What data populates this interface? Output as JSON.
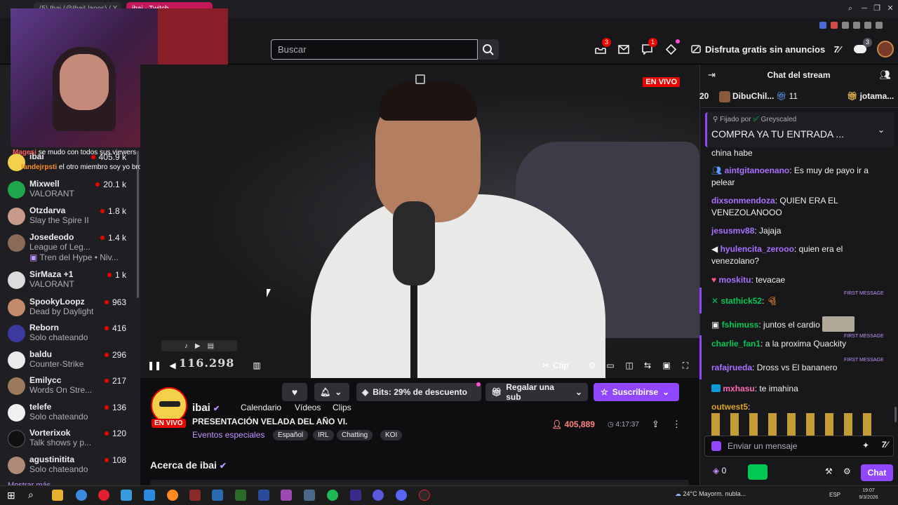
{
  "browser": {
    "tabs": [
      {
        "label": "(5) Ibai (@IbaiLlanos) / X"
      },
      {
        "label": "ibai - Twitch"
      }
    ]
  },
  "topnav": {
    "search_placeholder": "Buscar",
    "notif_badge_1": "3",
    "notif_badge_2": "1",
    "notif_badge_3": "3",
    "no_ads_label": "Disfruta gratis sin anuncios"
  },
  "webcam_overlay": {
    "line1_user": "Magesi",
    "line1_text": "se mudo con todos sus viewers",
    "line2_user": "fandejrpsti",
    "line2_text": "el otro miembro soy yo bro"
  },
  "sidebar": {
    "items": [
      {
        "name": "ibai",
        "game": "",
        "viewers": "405.9 k",
        "color": "#f2d04a"
      },
      {
        "name": "Mixwell",
        "game": "VALORANT",
        "viewers": "20.1 k",
        "color": "#1fa64a"
      },
      {
        "name": "Otzdarva",
        "game": "Slay the Spire II",
        "viewers": "1.8 k",
        "color": "#c79a8a"
      },
      {
        "name": "Josedeodo",
        "game": "League of Leg...",
        "viewers": "1.4 k",
        "color": "#8a6a58"
      },
      {
        "name": "SirMaza +1",
        "game": "VALORANT",
        "viewers": "1 k",
        "color": "#dcdcdc"
      },
      {
        "name": "SpookyLoopz",
        "game": "Dead by Daylight",
        "viewers": "963",
        "color": "#c28a6a"
      },
      {
        "name": "Reborn",
        "game": "Solo chateando",
        "viewers": "416",
        "color": "#3a3aa0"
      },
      {
        "name": "baldu",
        "game": "Counter-Strike",
        "viewers": "296",
        "color": "#eaeaea"
      },
      {
        "name": "Emilycc",
        "game": "Words On Stre...",
        "viewers": "217",
        "color": "#9a7a5a"
      },
      {
        "name": "telefe",
        "game": "Solo chateando",
        "viewers": "136",
        "color": "#f0f0f0"
      },
      {
        "name": "Vorterixok",
        "game": "Talk shows y p...",
        "viewers": "120",
        "color": "#111111"
      },
      {
        "name": "agustinitita",
        "game": "Solo chateando",
        "viewers": "108",
        "color": "#b08878"
      }
    ],
    "hype_train": "Tren del Hype • Niv...",
    "show_more": "Mostrar más"
  },
  "video": {
    "live_badge": "EN VIVO",
    "counter": "116.298",
    "clip_label": "Clip"
  },
  "channel": {
    "name": "ibai",
    "live": "EN VIVO",
    "tabs": [
      "Calendario",
      "Vídeos",
      "Clips"
    ],
    "title": "PRESENTACIÓN VELADA DEL AÑO VI.",
    "category": "Eventos especiales",
    "tags": [
      "Español",
      "IRL",
      "Chatting",
      "KOI"
    ],
    "bits_label": "Bits: 29% de descuento",
    "gift_label": "Regalar una sub",
    "subscribe_label": "Suscribirse",
    "viewers": "405,889",
    "uptime": "4:17:37",
    "about": "Acerca de ibai"
  },
  "chat": {
    "title": "Chat del stream",
    "gift_rank": "20",
    "gift_user_1": "DibuChil...",
    "gift_count_1": "11",
    "gift_user_2": "jotama...",
    "pinned_by_label": "Fijado por",
    "pinned_by_user": "Greyscaled",
    "pinned_text": "COMPRA YA TU ENTRADA ...",
    "first_message_label": "FIRST MESSAGE",
    "messages": [
      {
        "user": "",
        "text": "china habe",
        "color": "#efeff1"
      },
      {
        "user": "aintgitanoenano",
        "text": ": Es muy de payo ir a pelear",
        "color": "#a970ff"
      },
      {
        "user": "dixsonmendoza",
        "text": ": QUIEN ERA EL VENEZOLANOOO",
        "color": "#a970ff"
      },
      {
        "user": "jesusmv88",
        "text": ": Jajaja",
        "color": "#a970ff"
      },
      {
        "user": "hyulencita_zerooo",
        "text": ": quien era el venezolano?",
        "color": "#a970ff"
      },
      {
        "user": "moskitu",
        "text": ": tevacae",
        "color": "#a970ff"
      },
      {
        "user": "stathick52",
        "text": ":",
        "color": "#00c853"
      },
      {
        "user": "fshimuss",
        "text": ": juntos el cardio",
        "color": "#00c853"
      },
      {
        "user": "charlie_fan1",
        "text": ": a la proxima Quackity",
        "color": "#00c853"
      },
      {
        "user": "rafajrueda",
        "text": ": Dross vs El bananero",
        "color": "#a970ff"
      },
      {
        "user": "mxhasu",
        "text": ": te imahina",
        "color": "#ff69b4"
      },
      {
        "user": "outwest5",
        "text": ":",
        "color": "#daa520"
      }
    ],
    "input_placeholder": "Enviar un mensaje",
    "points": "0",
    "chat_button": "Chat"
  },
  "taskbar": {
    "weather": "24°C  Mayorm. nubla...",
    "lang": "ESP",
    "time": "19:07",
    "date": "9/3/2026"
  }
}
